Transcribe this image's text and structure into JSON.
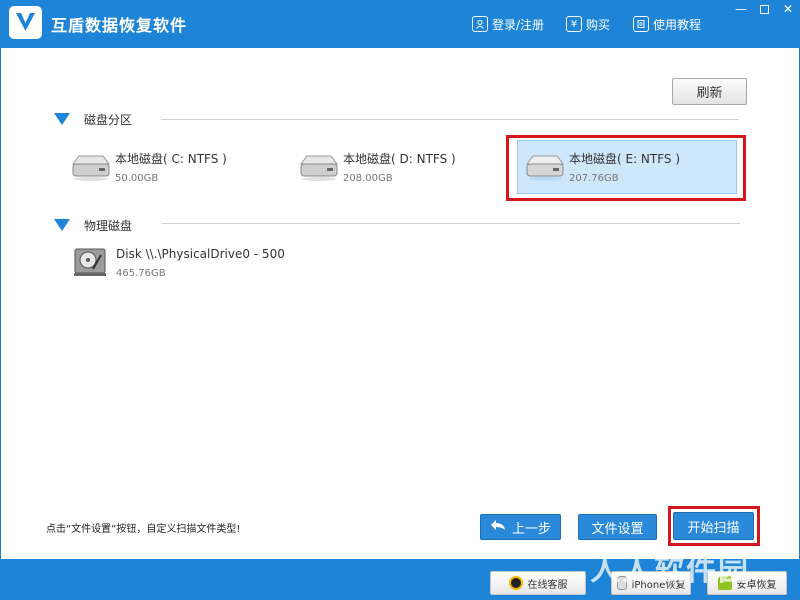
{
  "app": {
    "title": "互盾数据恢复软件"
  },
  "topbar": {
    "login_label": "登录/注册",
    "buy_label": "购买",
    "buy_icon_glyph": "¥",
    "tutorial_label": "使用教程",
    "minimize_glyph": "—",
    "close_glyph": "✕"
  },
  "toolbar": {
    "refresh_label": "刷新"
  },
  "sections": {
    "partitions_label": "磁盘分区",
    "physical_label": "物理磁盘"
  },
  "partitions": [
    {
      "name": "本地磁盘( C: NTFS )",
      "size": "50.00GB",
      "selected": false
    },
    {
      "name": "本地磁盘( D: NTFS )",
      "size": "208.00GB",
      "selected": false
    },
    {
      "name": "本地磁盘( E: NTFS )",
      "size": "207.76GB",
      "selected": true
    }
  ],
  "physical_disks": [
    {
      "name": "Disk \\\\.\\PhysicalDrive0 - 500",
      "size": "465.76GB"
    }
  ],
  "footer": {
    "hint": "点击“文件设置”按钮，自定义扫描文件类型!",
    "prev_label": "上一步",
    "settings_label": "文件设置",
    "start_label": "开始扫描"
  },
  "bottombar": {
    "online_support_label": "在线客服",
    "iphone_label": "iPhone恢复",
    "android_label": "安卓恢复",
    "watermark": "人人软件园"
  },
  "colors": {
    "brand_blue": "#1d84d7",
    "highlight_red": "#d4171c",
    "selection_bg": "#cfe7fb"
  }
}
